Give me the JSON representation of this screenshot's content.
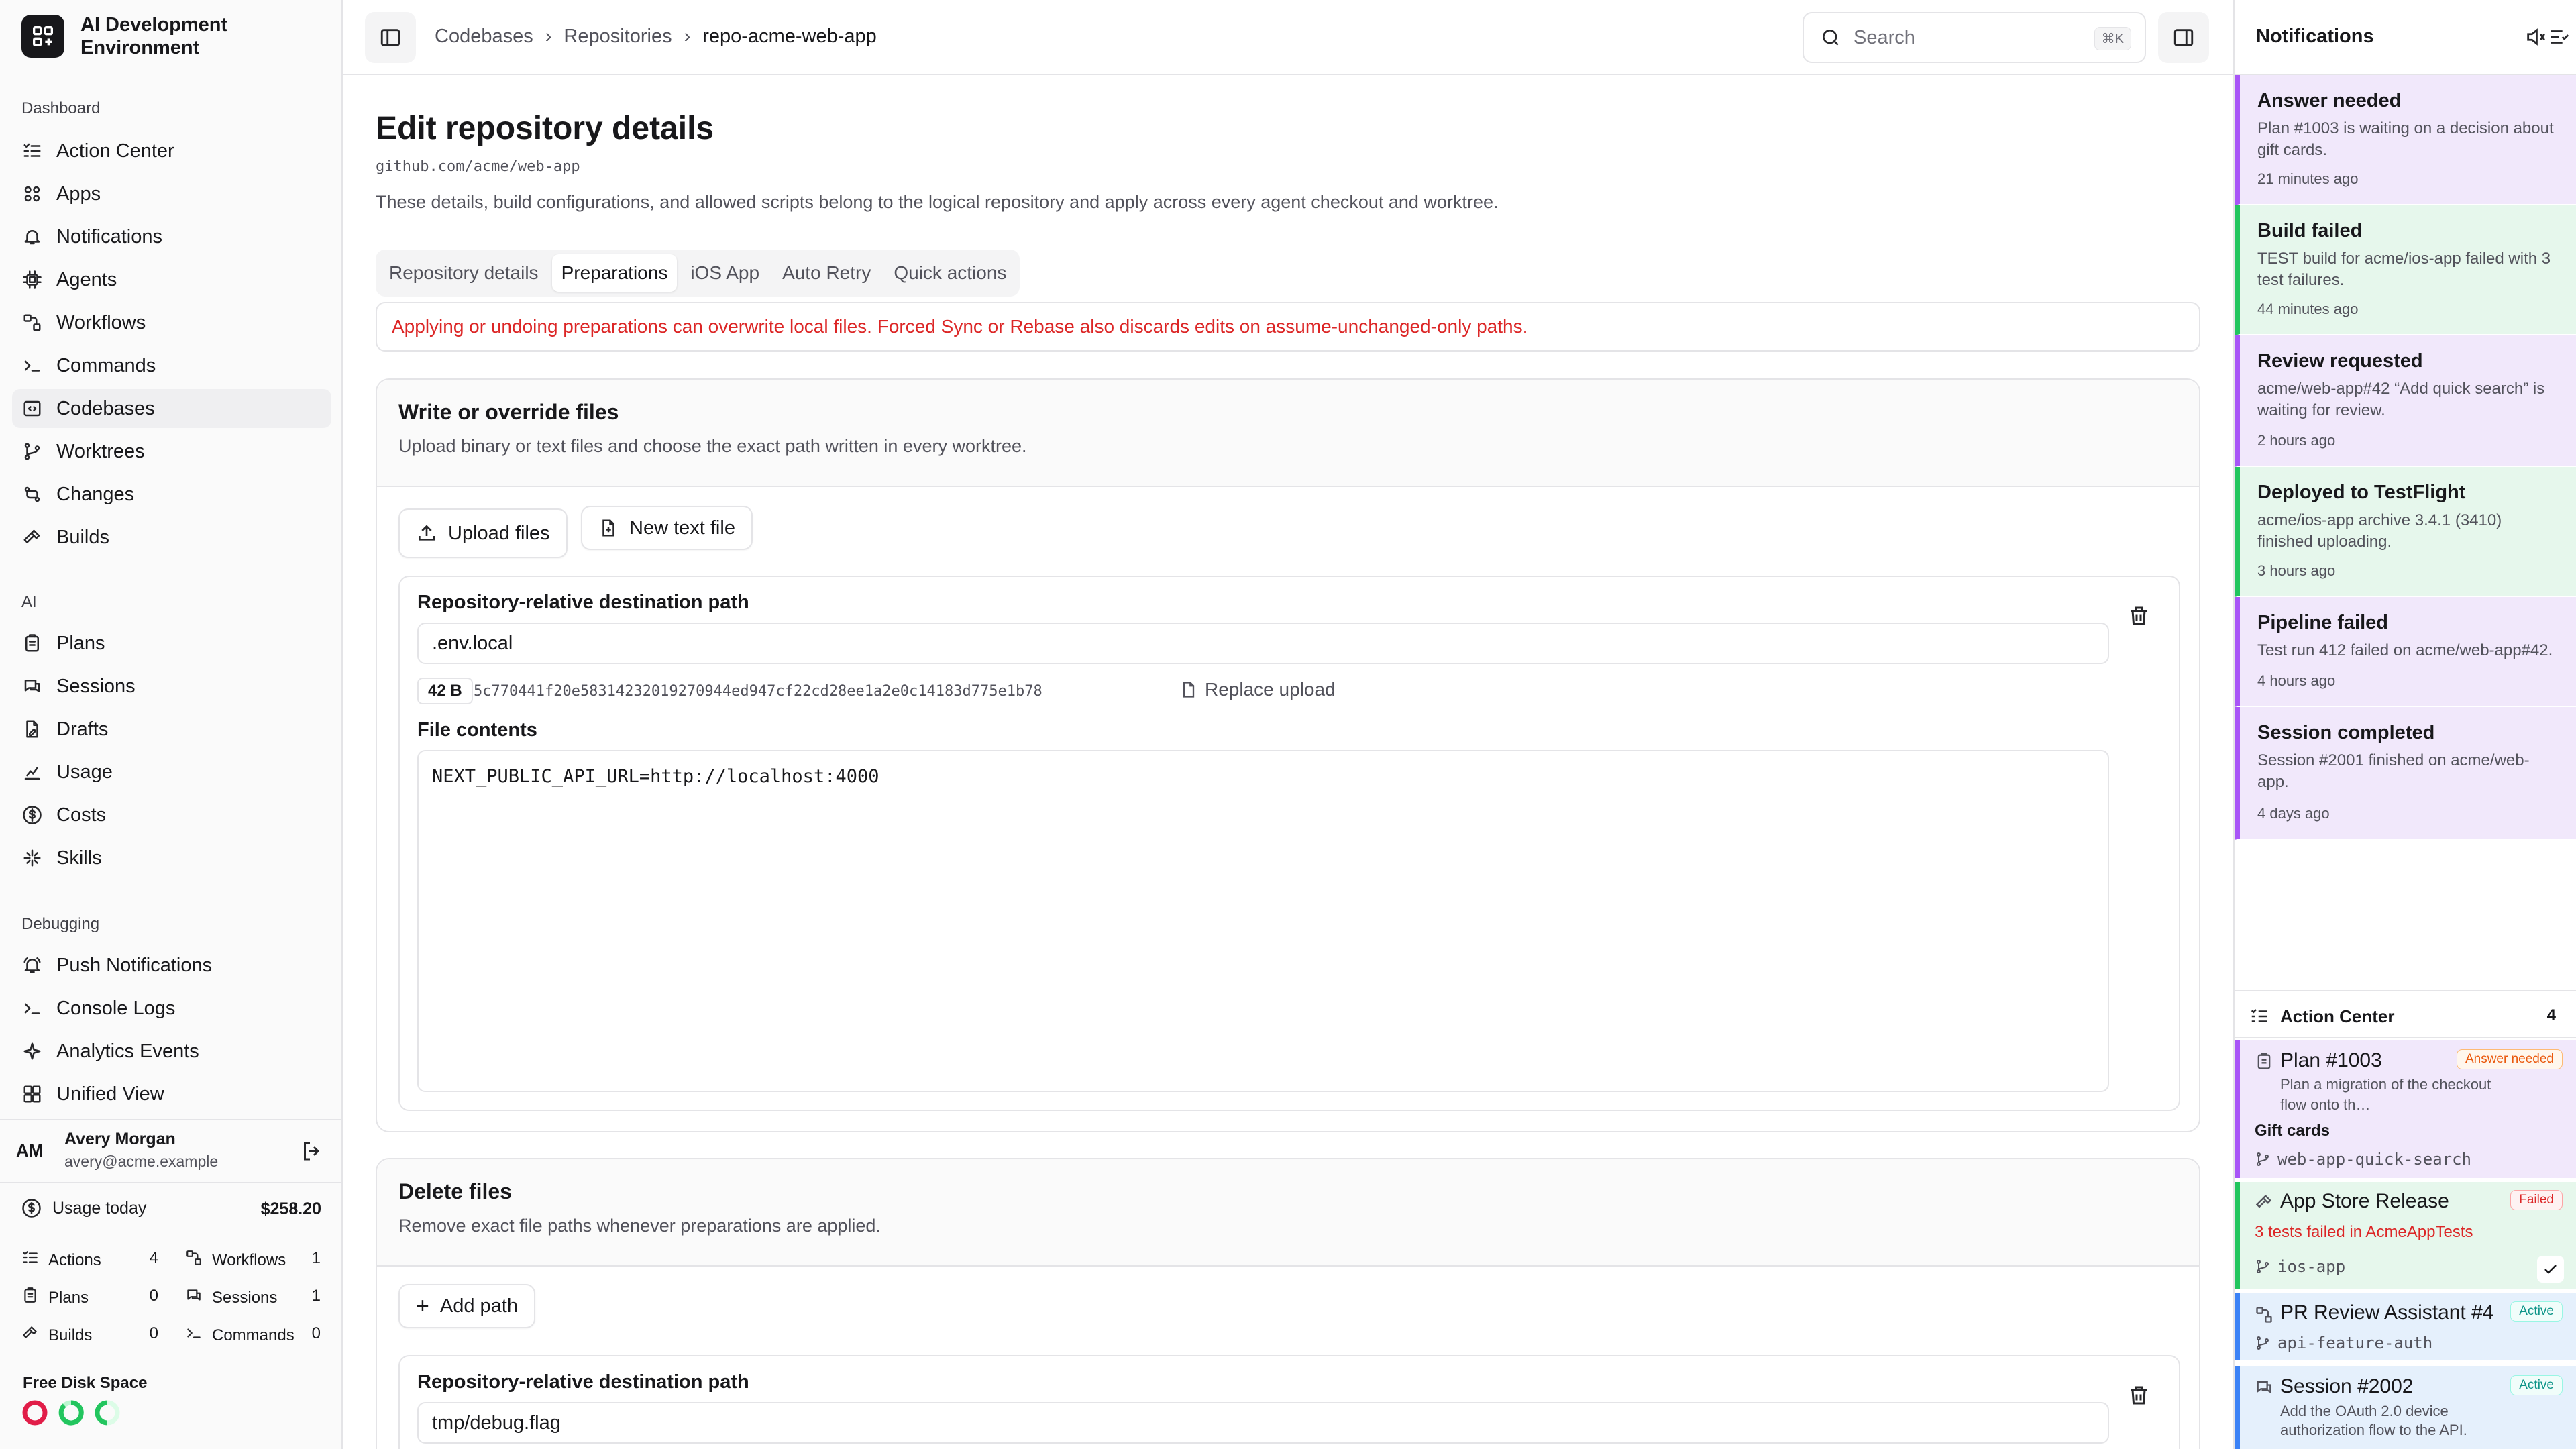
{
  "app": {
    "title": "AI Development Environment"
  },
  "sidebar": {
    "sections": [
      {
        "title": "Dashboard",
        "items": [
          {
            "label": "Action Center",
            "icon": "list-check-icon"
          },
          {
            "label": "Apps",
            "icon": "apps-icon"
          },
          {
            "label": "Notifications",
            "icon": "bell-icon"
          },
          {
            "label": "Agents",
            "icon": "cpu-icon"
          },
          {
            "label": "Workflows",
            "icon": "workflow-icon"
          },
          {
            "label": "Commands",
            "icon": "terminal-icon"
          },
          {
            "label": "Codebases",
            "icon": "codebase-icon",
            "active": true
          },
          {
            "label": "Worktrees",
            "icon": "git-branch-icon"
          },
          {
            "label": "Changes",
            "icon": "git-compare-icon"
          },
          {
            "label": "Builds",
            "icon": "hammer-icon"
          }
        ]
      },
      {
        "title": "AI",
        "items": [
          {
            "label": "Plans",
            "icon": "clipboard-icon"
          },
          {
            "label": "Sessions",
            "icon": "chat-icon"
          },
          {
            "label": "Drafts",
            "icon": "file-edit-icon"
          },
          {
            "label": "Usage",
            "icon": "chart-icon"
          },
          {
            "label": "Costs",
            "icon": "dollar-icon"
          },
          {
            "label": "Skills",
            "icon": "skills-icon"
          }
        ]
      },
      {
        "title": "Debugging",
        "items": [
          {
            "label": "Push Notifications",
            "icon": "bell-ring-icon"
          },
          {
            "label": "Console Logs",
            "icon": "terminal-icon"
          },
          {
            "label": "Analytics Events",
            "icon": "sparkle-icon"
          },
          {
            "label": "Unified View",
            "icon": "grid-icon"
          }
        ]
      }
    ],
    "user": {
      "initials": "AM",
      "name": "Avery Morgan",
      "email": "avery@acme.example"
    },
    "usage": {
      "label": "Usage today",
      "amount": "$258.20",
      "stats": [
        {
          "label": "Actions",
          "value": "4"
        },
        {
          "label": "Workflows",
          "value": "1"
        },
        {
          "label": "Plans",
          "value": "0"
        },
        {
          "label": "Sessions",
          "value": "1"
        },
        {
          "label": "Builds",
          "value": "0"
        },
        {
          "label": "Commands",
          "value": "0"
        }
      ],
      "disk_label": "Free Disk Space"
    }
  },
  "topbar": {
    "breadcrumbs": [
      "Codebases",
      "Repositories",
      "repo-acme-web-app"
    ],
    "search_placeholder": "Search",
    "search_shortcut": "⌘K"
  },
  "main": {
    "title": "Edit repository details",
    "repo_url": "github.com/acme/web-app",
    "description": "These details, build configurations, and allowed scripts belong to the logical repository and apply across every agent checkout and worktree.",
    "tabs": [
      "Repository details",
      "Preparations",
      "iOS App",
      "Auto Retry",
      "Quick actions"
    ],
    "active_tab": "Preparations",
    "warning": "Applying or undoing preparations can overwrite local files. Forced Sync or Rebase also discards edits on assume-unchanged-only paths.",
    "write_section": {
      "title": "Write or override files",
      "subtitle": "Upload binary or text files and choose the exact path written in every worktree.",
      "upload_label": "Upload files",
      "new_file_label": "New text file",
      "file": {
        "path_label": "Repository-relative destination path",
        "path": ".env.local",
        "size": "42 B",
        "hash": "5c770441f20e58314232019270944ed947cf22cd28ee1a2e0c14183d775e1b78",
        "replace_label": "Replace upload",
        "contents_label": "File contents",
        "contents": "NEXT_PUBLIC_API_URL=http://localhost:4000"
      }
    },
    "delete_section": {
      "title": "Delete files",
      "subtitle": "Remove exact file paths whenever preparations are applied.",
      "add_label": "Add path",
      "file": {
        "path_label": "Repository-relative destination path",
        "path": "tmp/debug.flag"
      }
    }
  },
  "notifications": {
    "title": "Notifications",
    "items": [
      {
        "title": "Answer needed",
        "body": "Plan #1003 is waiting on a decision about gift cards.",
        "time": "21 minutes ago",
        "kind": "purple"
      },
      {
        "title": "Build failed",
        "body": "TEST build for acme/ios-app failed with 3 test failures.",
        "time": "44 minutes ago",
        "kind": "green"
      },
      {
        "title": "Review requested",
        "body": "acme/web-app#42 “Add quick search” is waiting for review.",
        "time": "2 hours ago",
        "kind": "purple"
      },
      {
        "title": "Deployed to TestFlight",
        "body": "acme/ios-app archive 3.4.1 (3410) finished uploading.",
        "time": "3 hours ago",
        "kind": "green"
      },
      {
        "title": "Pipeline failed",
        "body": "Test run 412 failed on acme/web-app#42.",
        "time": "4 hours ago",
        "kind": "purple"
      },
      {
        "title": "Session completed",
        "body": "Session #2001 finished on acme/web-app.",
        "time": "4 days ago",
        "kind": "purple"
      }
    ],
    "action_center": {
      "title": "Action Center",
      "count": "4",
      "items": [
        {
          "title": "Plan #1003",
          "badge": "Answer needed",
          "sub": "Plan a migration of the checkout flow onto th…",
          "extra": "Gift cards",
          "branch": "web-app-quick-search"
        },
        {
          "title": "App Store Release",
          "badge": "Failed",
          "sub": "3 tests failed in AcmeAppTests",
          "branch": "ios-app"
        },
        {
          "title": "PR Review Assistant #4…",
          "badge": "Active",
          "branch": "api-feature-auth"
        },
        {
          "title": "Session #2002",
          "badge": "Active",
          "sub": "Add the OAuth 2.0 device authorization flow to the API."
        }
      ]
    }
  },
  "colors": {
    "purple_bg": "#f1e8fb",
    "purple_border": "#a855f7",
    "green_bg": "#e6f7ec",
    "green_border": "#22c55e",
    "blue_bg": "#e5f0fc",
    "blue_border": "#3b82f6",
    "danger": "#dc2626"
  }
}
